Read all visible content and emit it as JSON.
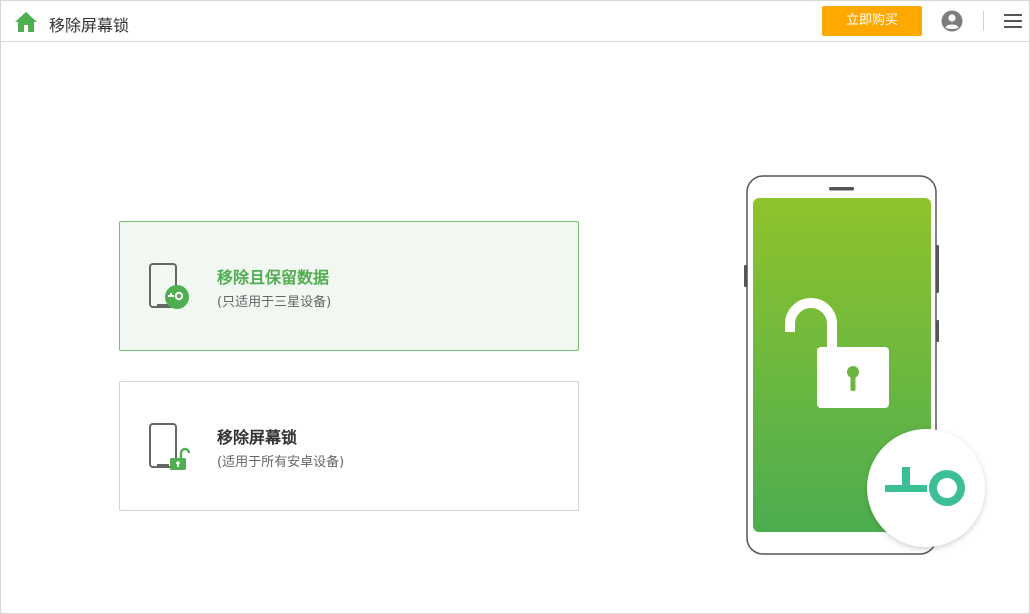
{
  "header": {
    "title": "移除屏幕锁",
    "buy_label": "立即购买"
  },
  "options": [
    {
      "title": "移除且保留数据",
      "subtitle": "(只适用于三星设备)",
      "selected": true,
      "icon": "phone-key-icon"
    },
    {
      "title": "移除屏幕锁",
      "subtitle": "(适用于所有安卓设备)",
      "selected": false,
      "icon": "phone-unlock-icon"
    }
  ],
  "colors": {
    "accent_green": "#52ad52",
    "buy_orange": "#ffa800",
    "key_teal": "#3cbf96"
  },
  "icons": [
    "home-icon",
    "user-icon",
    "menu-icon",
    "phone-key-icon",
    "phone-unlock-icon",
    "unlocked-padlock-icon",
    "key-badge-icon"
  ]
}
